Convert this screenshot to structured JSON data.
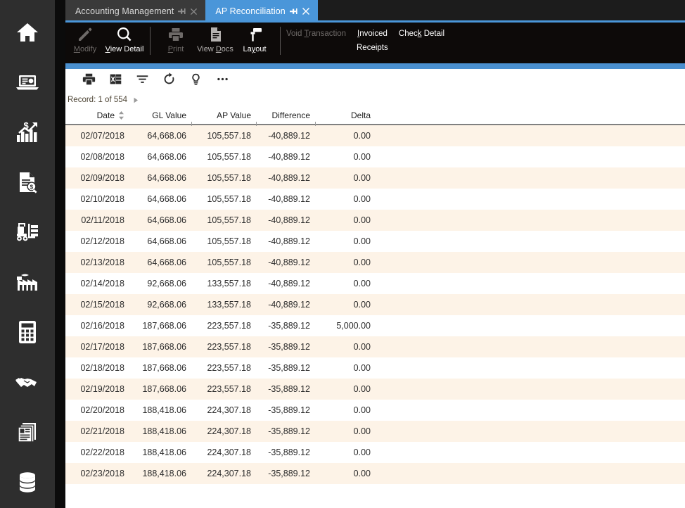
{
  "sidebar": {
    "items": [
      {
        "name": "home",
        "icon": "home-icon"
      },
      {
        "name": "workstation",
        "icon": "laptop-icon"
      },
      {
        "name": "financials",
        "icon": "financial-growth-chart-icon"
      },
      {
        "name": "document-inquiry",
        "icon": "document-search-icon"
      },
      {
        "name": "warehouse",
        "icon": "forklift-icon"
      },
      {
        "name": "manufacturing",
        "icon": "factory-icon"
      },
      {
        "name": "accounting",
        "icon": "calculator-icon"
      },
      {
        "name": "partners",
        "icon": "handshake-icon"
      },
      {
        "name": "reports",
        "icon": "documents-icon"
      },
      {
        "name": "data",
        "icon": "database-icon"
      }
    ]
  },
  "tabs": [
    {
      "label": "Accounting Management",
      "active": false,
      "pin_icon": "pin-icon",
      "close_icon": "close-icon"
    },
    {
      "label": "AP Reconciliation",
      "active": true,
      "pin_icon": "pin-icon",
      "close_icon": "close-icon"
    }
  ],
  "ribbon": {
    "buttons": [
      {
        "label": "Modify",
        "accel": "M",
        "icon": "pencil-icon",
        "state": "dim"
      },
      {
        "label": "View Detail",
        "accel": "V",
        "icon": "magnifier-icon",
        "state": "lit"
      },
      {
        "label": "Print",
        "accel": "P",
        "icon": "printer-icon",
        "state": "dim"
      },
      {
        "label": "View Docs",
        "accel": "D",
        "icon": "document-icon",
        "state": "mid"
      },
      {
        "label": "Layout",
        "accel": "y",
        "icon": "paint-roller-icon",
        "state": "lit"
      }
    ],
    "links": [
      {
        "label": "Void Transaction",
        "accel": "T",
        "state": "dim"
      },
      {
        "label": "Invoiced",
        "accel": "I",
        "state": "lit"
      },
      {
        "label": "Check Detail",
        "accel": "k",
        "state": "lit"
      },
      {
        "label": "Receipts",
        "accel": "",
        "state": "lit"
      }
    ]
  },
  "grid_toolbar": {
    "buttons": [
      {
        "name": "print-grid",
        "icon": "printer-icon"
      },
      {
        "name": "export-excel",
        "icon": "excel-export-icon"
      },
      {
        "name": "filter",
        "icon": "filter-icon"
      },
      {
        "name": "refresh",
        "icon": "refresh-icon"
      },
      {
        "name": "hint",
        "icon": "lightbulb-icon"
      },
      {
        "name": "more-options",
        "icon": "ellipsis-icon"
      }
    ]
  },
  "record_bar": {
    "text": "Record: 1 of 554",
    "next_icon": "triangle-right-icon"
  },
  "grid": {
    "columns": [
      {
        "key": "date",
        "label": "Date",
        "sorted": true,
        "sort_icon": "sort-arrows-icon"
      },
      {
        "key": "gl",
        "label": "GL Value",
        "sorted": false
      },
      {
        "key": "ap",
        "label": "AP Value",
        "sorted": false
      },
      {
        "key": "diff",
        "label": "Difference",
        "sorted": false
      },
      {
        "key": "delta",
        "label": "Delta",
        "sorted": false
      }
    ],
    "rows": [
      {
        "date": "02/07/2018",
        "gl": "64,668.06",
        "ap": "105,557.18",
        "diff": "-40,889.12",
        "delta": "0.00"
      },
      {
        "date": "02/08/2018",
        "gl": "64,668.06",
        "ap": "105,557.18",
        "diff": "-40,889.12",
        "delta": "0.00"
      },
      {
        "date": "02/09/2018",
        "gl": "64,668.06",
        "ap": "105,557.18",
        "diff": "-40,889.12",
        "delta": "0.00"
      },
      {
        "date": "02/10/2018",
        "gl": "64,668.06",
        "ap": "105,557.18",
        "diff": "-40,889.12",
        "delta": "0.00"
      },
      {
        "date": "02/11/2018",
        "gl": "64,668.06",
        "ap": "105,557.18",
        "diff": "-40,889.12",
        "delta": "0.00"
      },
      {
        "date": "02/12/2018",
        "gl": "64,668.06",
        "ap": "105,557.18",
        "diff": "-40,889.12",
        "delta": "0.00"
      },
      {
        "date": "02/13/2018",
        "gl": "64,668.06",
        "ap": "105,557.18",
        "diff": "-40,889.12",
        "delta": "0.00"
      },
      {
        "date": "02/14/2018",
        "gl": "92,668.06",
        "ap": "133,557.18",
        "diff": "-40,889.12",
        "delta": "0.00"
      },
      {
        "date": "02/15/2018",
        "gl": "92,668.06",
        "ap": "133,557.18",
        "diff": "-40,889.12",
        "delta": "0.00"
      },
      {
        "date": "02/16/2018",
        "gl": "187,668.06",
        "ap": "223,557.18",
        "diff": "-35,889.12",
        "delta": "5,000.00"
      },
      {
        "date": "02/17/2018",
        "gl": "187,668.06",
        "ap": "223,557.18",
        "diff": "-35,889.12",
        "delta": "0.00"
      },
      {
        "date": "02/18/2018",
        "gl": "187,668.06",
        "ap": "223,557.18",
        "diff": "-35,889.12",
        "delta": "0.00"
      },
      {
        "date": "02/19/2018",
        "gl": "187,668.06",
        "ap": "223,557.18",
        "diff": "-35,889.12",
        "delta": "0.00"
      },
      {
        "date": "02/20/2018",
        "gl": "188,418.06",
        "ap": "224,307.18",
        "diff": "-35,889.12",
        "delta": "0.00"
      },
      {
        "date": "02/21/2018",
        "gl": "188,418.06",
        "ap": "224,307.18",
        "diff": "-35,889.12",
        "delta": "0.00"
      },
      {
        "date": "02/22/2018",
        "gl": "188,418.06",
        "ap": "224,307.18",
        "diff": "-35,889.12",
        "delta": "0.00"
      },
      {
        "date": "02/23/2018",
        "gl": "188,418.06",
        "ap": "224,307.18",
        "diff": "-35,889.12",
        "delta": "0.00"
      }
    ]
  },
  "colors": {
    "sidebar_bg": "#2e2e2e",
    "ribbon_bg": "#0d0a09",
    "tab_active_bg": "#4a96d9",
    "tab_inactive_bg": "#3a3a3a",
    "accent_bar": "#4a90cf",
    "row_stripe": "#fdf3e7",
    "row_plain": "#ffffff",
    "record_text": "#4d4434"
  }
}
